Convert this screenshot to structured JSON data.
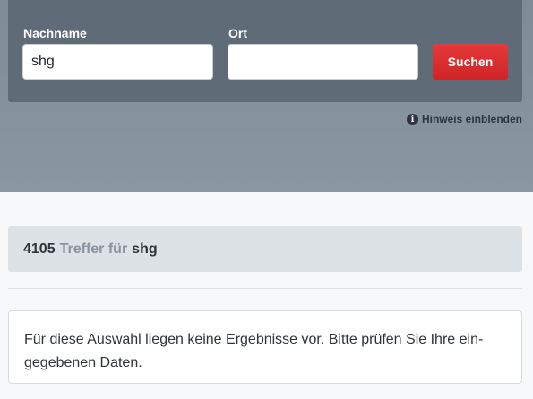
{
  "search": {
    "lastname_label": "Nachname",
    "lastname_value": "shg",
    "city_label": "Ort",
    "city_value": "",
    "submit_label": "Suchen"
  },
  "hint": {
    "icon": "info-icon",
    "label": "Hinweis einblenden"
  },
  "results": {
    "count": "4105",
    "mid_text": "Treffer für",
    "term": "shg"
  },
  "notice": {
    "text": "Für diese Auswahl liegen keine Ergebnisse vor. Bitte prüfen Sie Ihre ein-gegebenen Daten."
  },
  "colors": {
    "button": "#d92e2f",
    "panel": "#5f6c78",
    "hero": "#8592a0"
  }
}
